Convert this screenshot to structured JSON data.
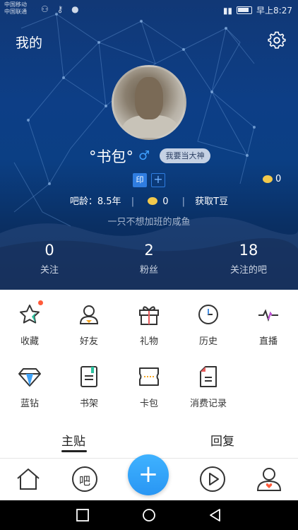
{
  "status_bar": {
    "carrier_line1": "中国移动",
    "carrier_line2": "中国联通",
    "time": "早上8:27"
  },
  "header": {
    "title": "我的",
    "icons": [
      "settings-gear-icon"
    ]
  },
  "profile": {
    "name": "°书包°",
    "gender_symbol": "♂",
    "god_button": "我要当大神",
    "badge_label": "印",
    "badge_add": "+",
    "coin_count": "0",
    "bar_age_label": "吧龄：8.5年",
    "separator": "|",
    "tdou_count": "0",
    "get_tdou": "获取T豆",
    "signature": "一只不想加班的咸鱼"
  },
  "stats": [
    {
      "value": "0",
      "label": "关注"
    },
    {
      "value": "2",
      "label": "粉丝"
    },
    {
      "value": "18",
      "label": "关注的吧"
    }
  ],
  "grid": [
    {
      "label": "收藏",
      "icon": "star-icon"
    },
    {
      "label": "好友",
      "icon": "friend-icon"
    },
    {
      "label": "礼物",
      "icon": "gift-icon"
    },
    {
      "label": "历史",
      "icon": "clock-icon"
    },
    {
      "label": "直播",
      "icon": "live-icon"
    },
    {
      "label": "蓝钻",
      "icon": "diamond-icon"
    },
    {
      "label": "书架",
      "icon": "bookshelf-icon"
    },
    {
      "label": "卡包",
      "icon": "card-icon"
    },
    {
      "label": "消费记录",
      "icon": "receipt-icon"
    }
  ],
  "tabs": [
    {
      "label": "主贴",
      "active": true
    },
    {
      "label": "回复",
      "active": false
    }
  ],
  "bottom_nav": {
    "bar_label": "吧",
    "fab_label": "+"
  },
  "colors": {
    "accent": "#2996f3",
    "header_bg": "#0d3e86",
    "notify_dot": "#ff5b3a"
  }
}
